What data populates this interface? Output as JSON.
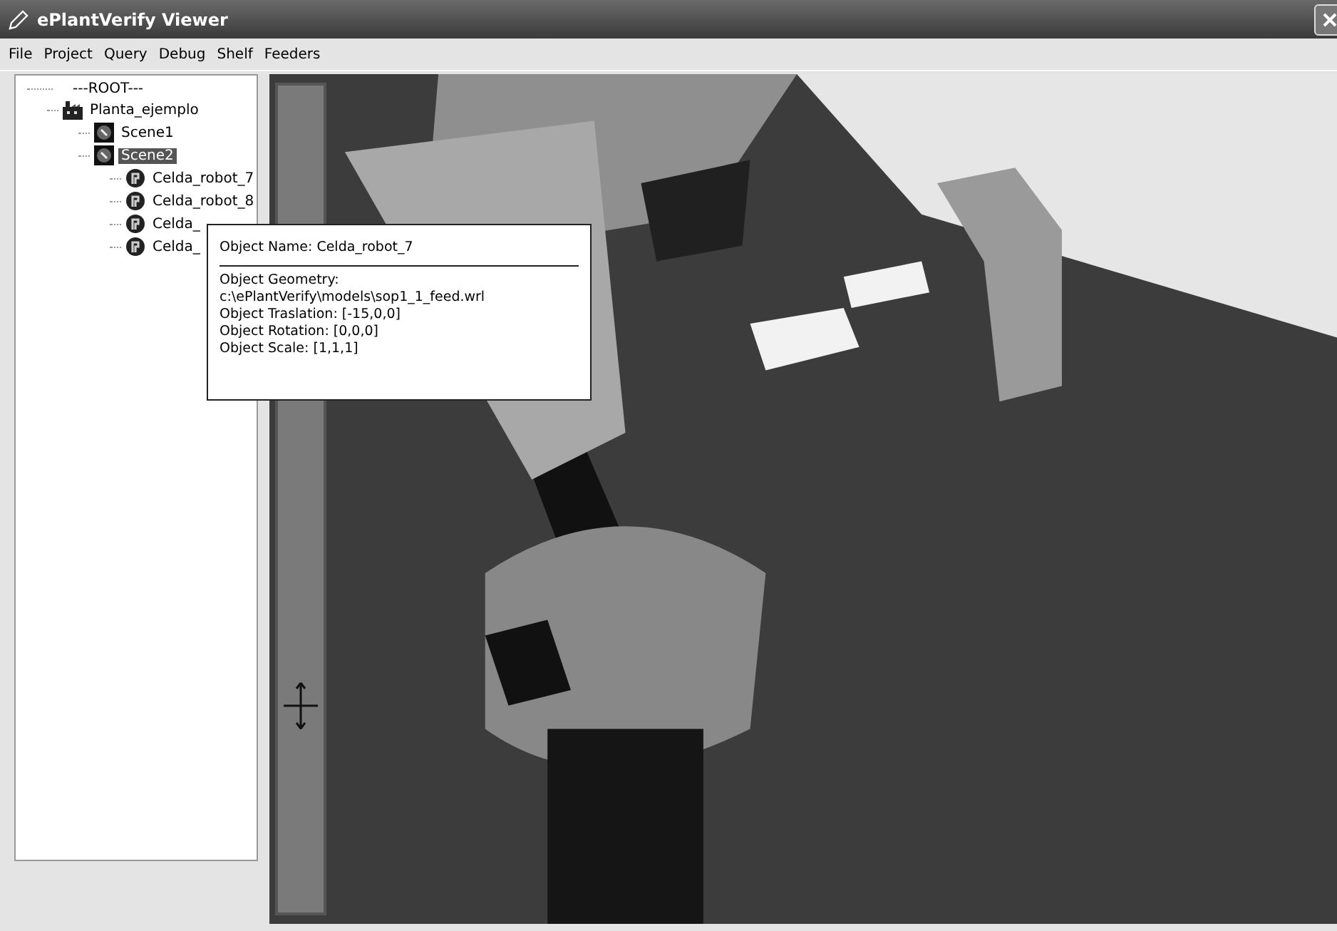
{
  "window": {
    "title": "ePlantVerify Viewer"
  },
  "menu": [
    "File",
    "Project",
    "Query",
    "Debug",
    "Shelf",
    "Feeders"
  ],
  "tree": {
    "label": "---ROOT---",
    "children": [
      {
        "label": "Planta_ejemplo",
        "kind": "plant",
        "selected": false,
        "children": [
          {
            "label": "Scene1",
            "kind": "scene",
            "selected": false
          },
          {
            "label": "Scene2",
            "kind": "scene",
            "selected": true,
            "children": [
              {
                "label": "Celda_robot_7",
                "kind": "robot",
                "selected": false
              },
              {
                "label": "Celda_robot_8",
                "kind": "robot",
                "selected": false
              },
              {
                "label": "Celda_",
                "kind": "robot",
                "selected": false
              },
              {
                "label": "Celda_",
                "kind": "robot",
                "selected": false
              }
            ]
          }
        ]
      }
    ]
  },
  "tooltip": {
    "title": "Object Name: Celda_robot_7",
    "lines": [
      "Object Geometry:",
      "c:\\ePlantVerify\\models\\sop1_1_feed.wrl",
      "Object Traslation: [-15,0,0]",
      "Object Rotation: [0,0,0]",
      "Object Scale: [1,1,1]"
    ]
  }
}
